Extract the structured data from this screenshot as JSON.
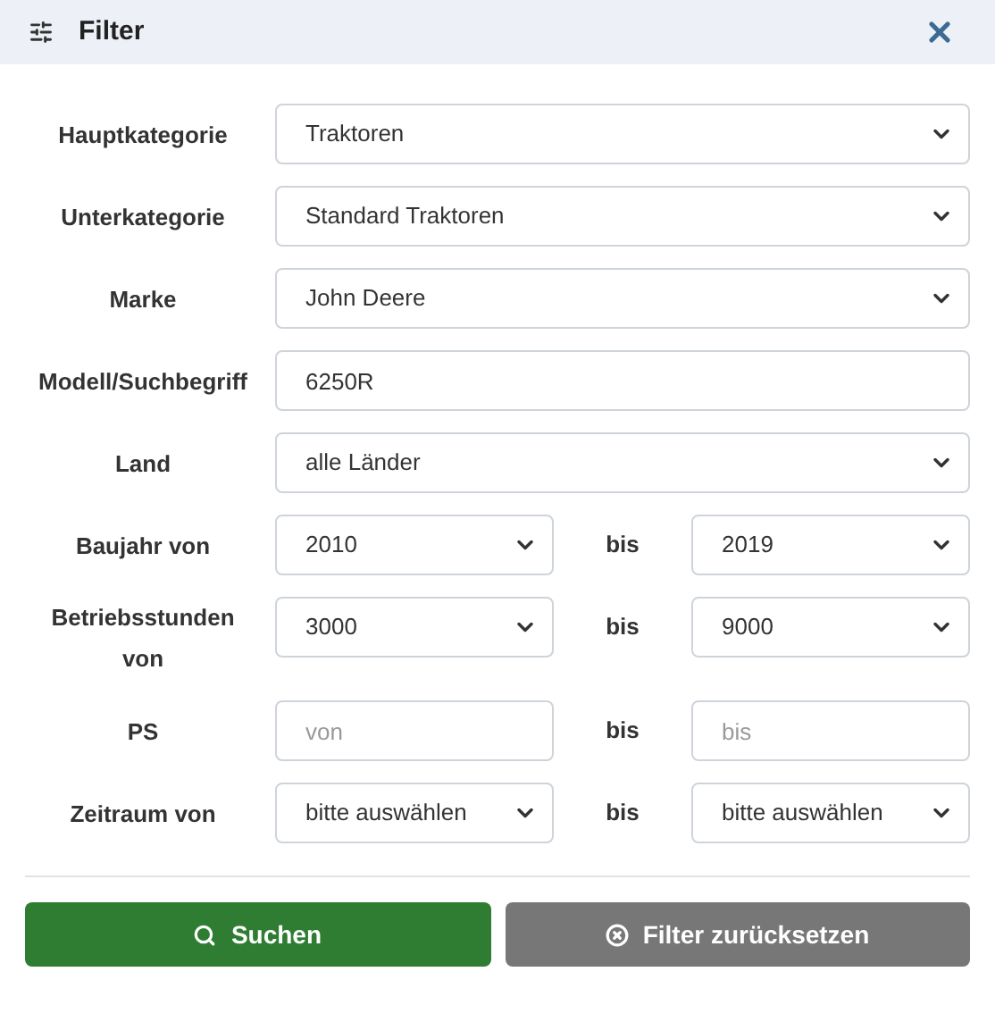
{
  "header": {
    "title": "Filter"
  },
  "rows": [
    {
      "kind": "single",
      "label": "Hauptkategorie",
      "field": {
        "kind": "select",
        "value": "Traktoren"
      }
    },
    {
      "kind": "single",
      "label": "Unterkategorie",
      "field": {
        "kind": "select",
        "value": "Standard Traktoren"
      }
    },
    {
      "kind": "single",
      "label": "Marke",
      "field": {
        "kind": "select",
        "value": "John Deere"
      }
    },
    {
      "kind": "single",
      "label": "Modell/Suchbegriff",
      "field": {
        "kind": "input",
        "value": "6250R"
      }
    },
    {
      "kind": "single",
      "label": "Land",
      "field": {
        "kind": "select",
        "value": "alle Länder"
      }
    },
    {
      "kind": "range",
      "label": "Baujahr von",
      "separator": "bis",
      "from": {
        "kind": "select",
        "value": "2010"
      },
      "to": {
        "kind": "select",
        "value": "2019"
      }
    },
    {
      "kind": "range",
      "label": "Betriebsstunden von",
      "separator": "bis",
      "from": {
        "kind": "select",
        "value": "3000"
      },
      "to": {
        "kind": "select",
        "value": "9000"
      }
    },
    {
      "kind": "range",
      "label": "PS",
      "separator": "bis",
      "from": {
        "kind": "input",
        "placeholder": "von"
      },
      "to": {
        "kind": "input",
        "placeholder": "bis"
      }
    },
    {
      "kind": "range",
      "label": "Zeitraum von",
      "separator": "bis",
      "from": {
        "kind": "select",
        "value": "bitte auswählen"
      },
      "to": {
        "kind": "select",
        "value": "bitte auswählen"
      }
    }
  ],
  "buttons": [
    {
      "kind": "search",
      "label": "Suchen"
    },
    {
      "kind": "reset",
      "label": "Filter zurücksetzen"
    }
  ]
}
